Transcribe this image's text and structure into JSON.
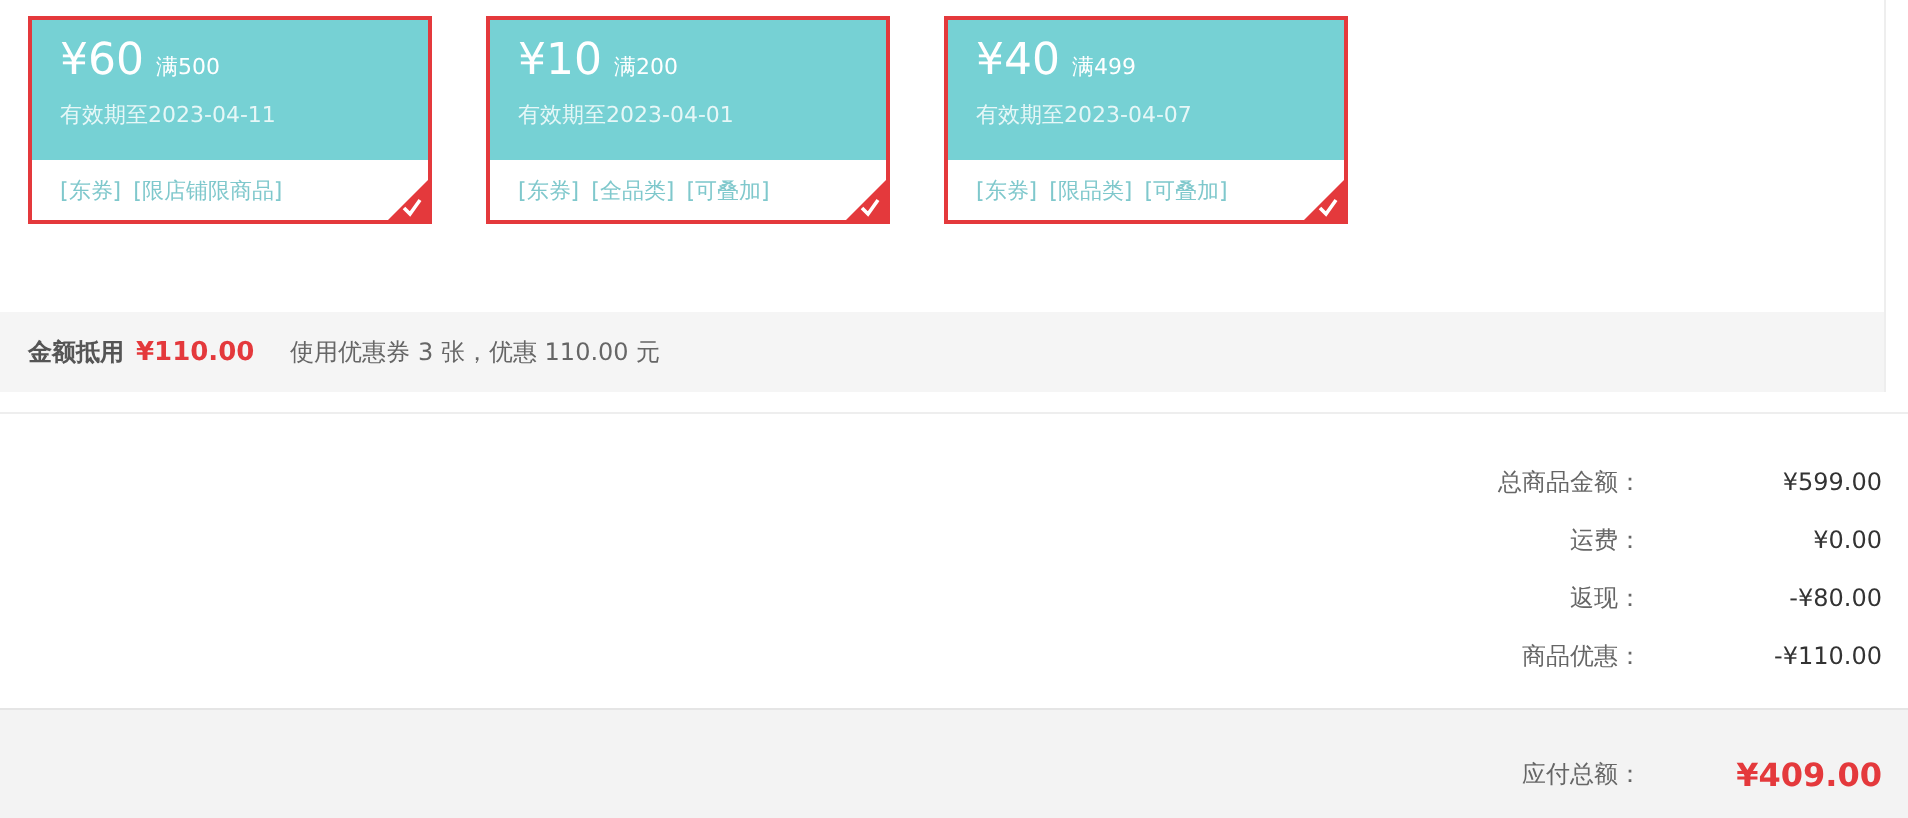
{
  "coupons": [
    {
      "amount": "¥60",
      "threshold": "满500",
      "validity": "有效期至2023-04-11",
      "tags": [
        "[东券]",
        "[限店铺限商品]"
      ],
      "selected": true
    },
    {
      "amount": "¥10",
      "threshold": "满200",
      "validity": "有效期至2023-04-01",
      "tags": [
        "[东券]",
        "[全品类]",
        "[可叠加]"
      ],
      "selected": true
    },
    {
      "amount": "¥40",
      "threshold": "满499",
      "validity": "有效期至2023-04-07",
      "tags": [
        "[东券]",
        "[限品类]",
        "[可叠加]"
      ],
      "selected": true
    }
  ],
  "deduction": {
    "label": "金额抵用",
    "amount": "¥110.00",
    "note": "使用优惠券 3 张，优惠 110.00 元"
  },
  "summary": [
    {
      "label": "总商品金额：",
      "value": "¥599.00"
    },
    {
      "label": "运费：",
      "value": "¥0.00"
    },
    {
      "label": "返现：",
      "value": "-¥80.00"
    },
    {
      "label": "商品优惠：",
      "value": "-¥110.00"
    }
  ],
  "total": {
    "label": "应付总额：",
    "value": "¥409.00"
  }
}
